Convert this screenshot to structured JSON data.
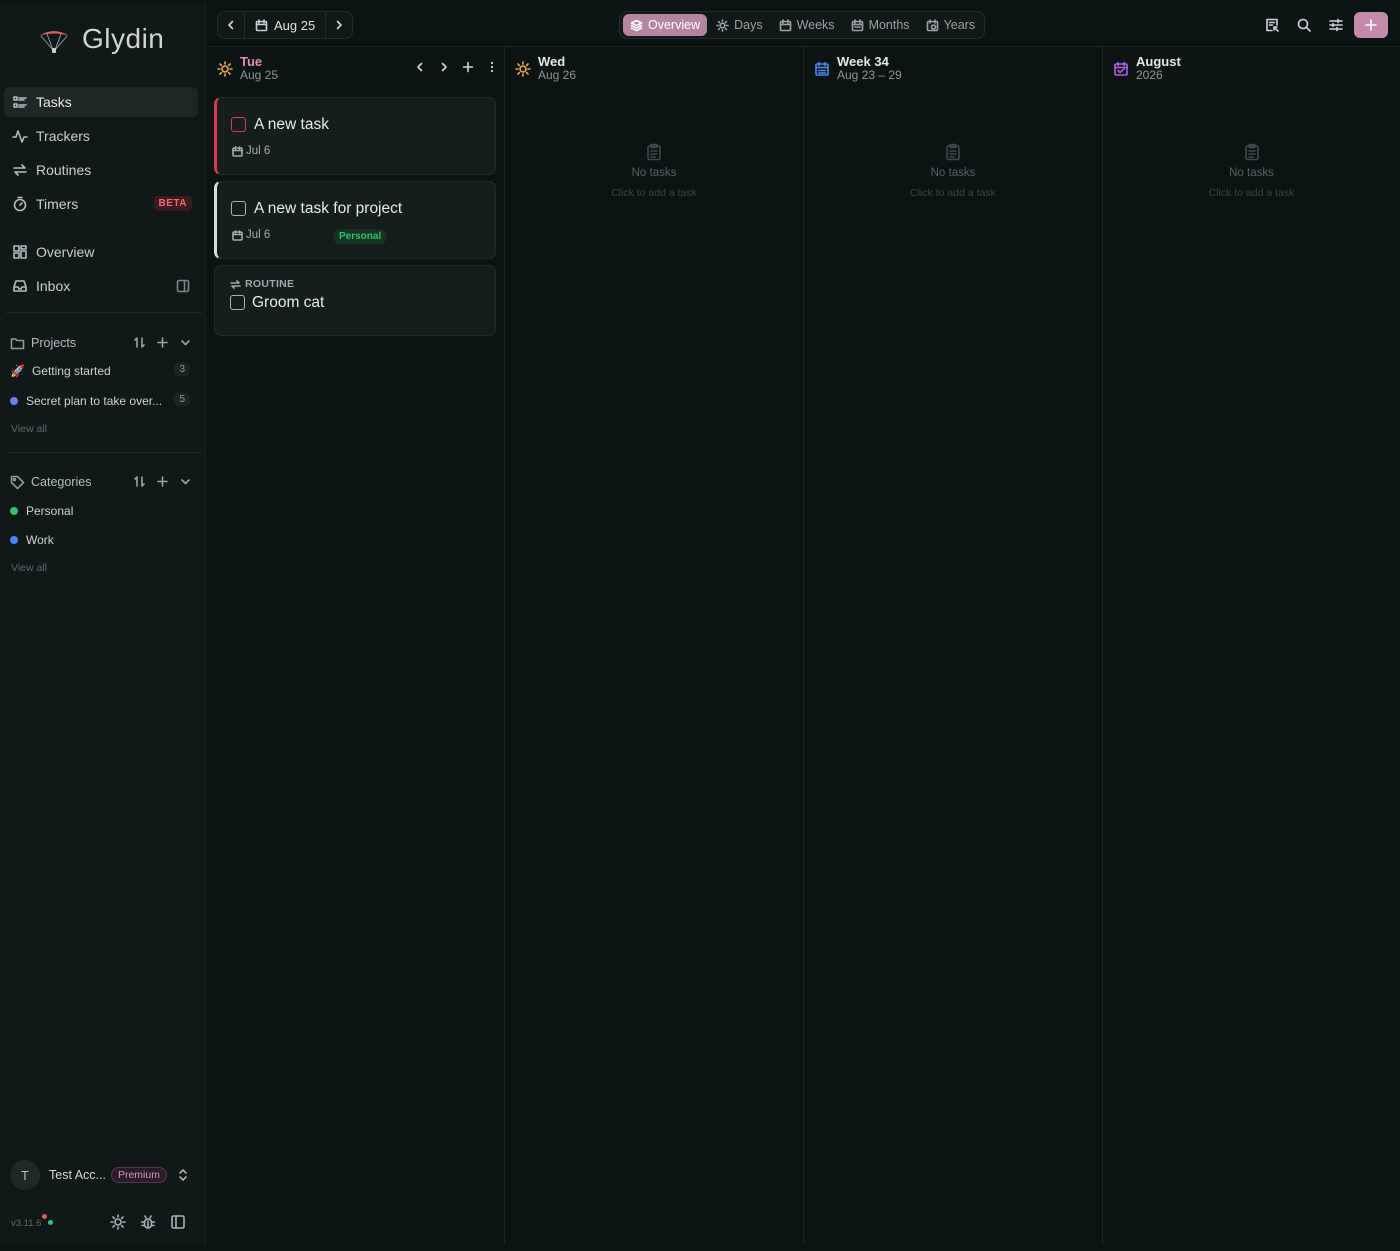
{
  "app": {
    "name": "Glydin"
  },
  "sidebar": {
    "nav": [
      {
        "label": "Tasks",
        "icon": "list-check-icon",
        "active": true
      },
      {
        "label": "Trackers",
        "icon": "activity-icon"
      },
      {
        "label": "Routines",
        "icon": "repeat-icon"
      },
      {
        "label": "Timers",
        "icon": "timer-icon",
        "badge": "BETA"
      },
      {
        "label": "Overview",
        "icon": "grid-icon"
      },
      {
        "label": "Inbox",
        "icon": "inbox-icon"
      }
    ],
    "projects": {
      "title": "Projects",
      "items": [
        {
          "label": "Getting started",
          "count": "3",
          "emoji": "🚀"
        },
        {
          "label": "Secret plan to take over...",
          "count": "5",
          "color": "#6f7cf2"
        }
      ],
      "view_all": "View all"
    },
    "categories": {
      "title": "Categories",
      "items": [
        {
          "label": "Personal",
          "color": "#2fc46a"
        },
        {
          "label": "Work",
          "color": "#4a86f0"
        }
      ],
      "view_all": "View all"
    },
    "account": {
      "initial": "T",
      "name": "Test Acc...",
      "plan": "Premium"
    },
    "version": "v3.11.6"
  },
  "topbar": {
    "date": "Aug 25",
    "views": [
      {
        "label": "Overview",
        "active": true
      },
      {
        "label": "Days"
      },
      {
        "label": "Weeks"
      },
      {
        "label": "Months"
      },
      {
        "label": "Years"
      }
    ]
  },
  "columns": [
    {
      "title": "Tue",
      "subtitle": "Aug 25",
      "accent": "#e98bb0",
      "icon": "sun-icon",
      "tasks": [
        {
          "title": "A new task",
          "date": "Jul 6",
          "accent": "red"
        },
        {
          "title": "A new task for project",
          "date": "Jul 6",
          "tag": "Personal",
          "accent": "white"
        },
        {
          "kind": "ROUTINE",
          "title": "Groom cat"
        }
      ]
    },
    {
      "title": "Wed",
      "subtitle": "Aug 26",
      "icon": "sun-icon",
      "empty_title": "No tasks",
      "empty_sub": "Click to add a task"
    },
    {
      "title": "Week 34",
      "subtitle": "Aug 23 – 29",
      "icon": "calendar-week-icon",
      "empty_title": "No tasks",
      "empty_sub": "Click to add a task"
    },
    {
      "title": "August",
      "subtitle": "2026",
      "icon": "calendar-month-icon",
      "empty_title": "No tasks",
      "empty_sub": "Click to add a task"
    }
  ]
}
